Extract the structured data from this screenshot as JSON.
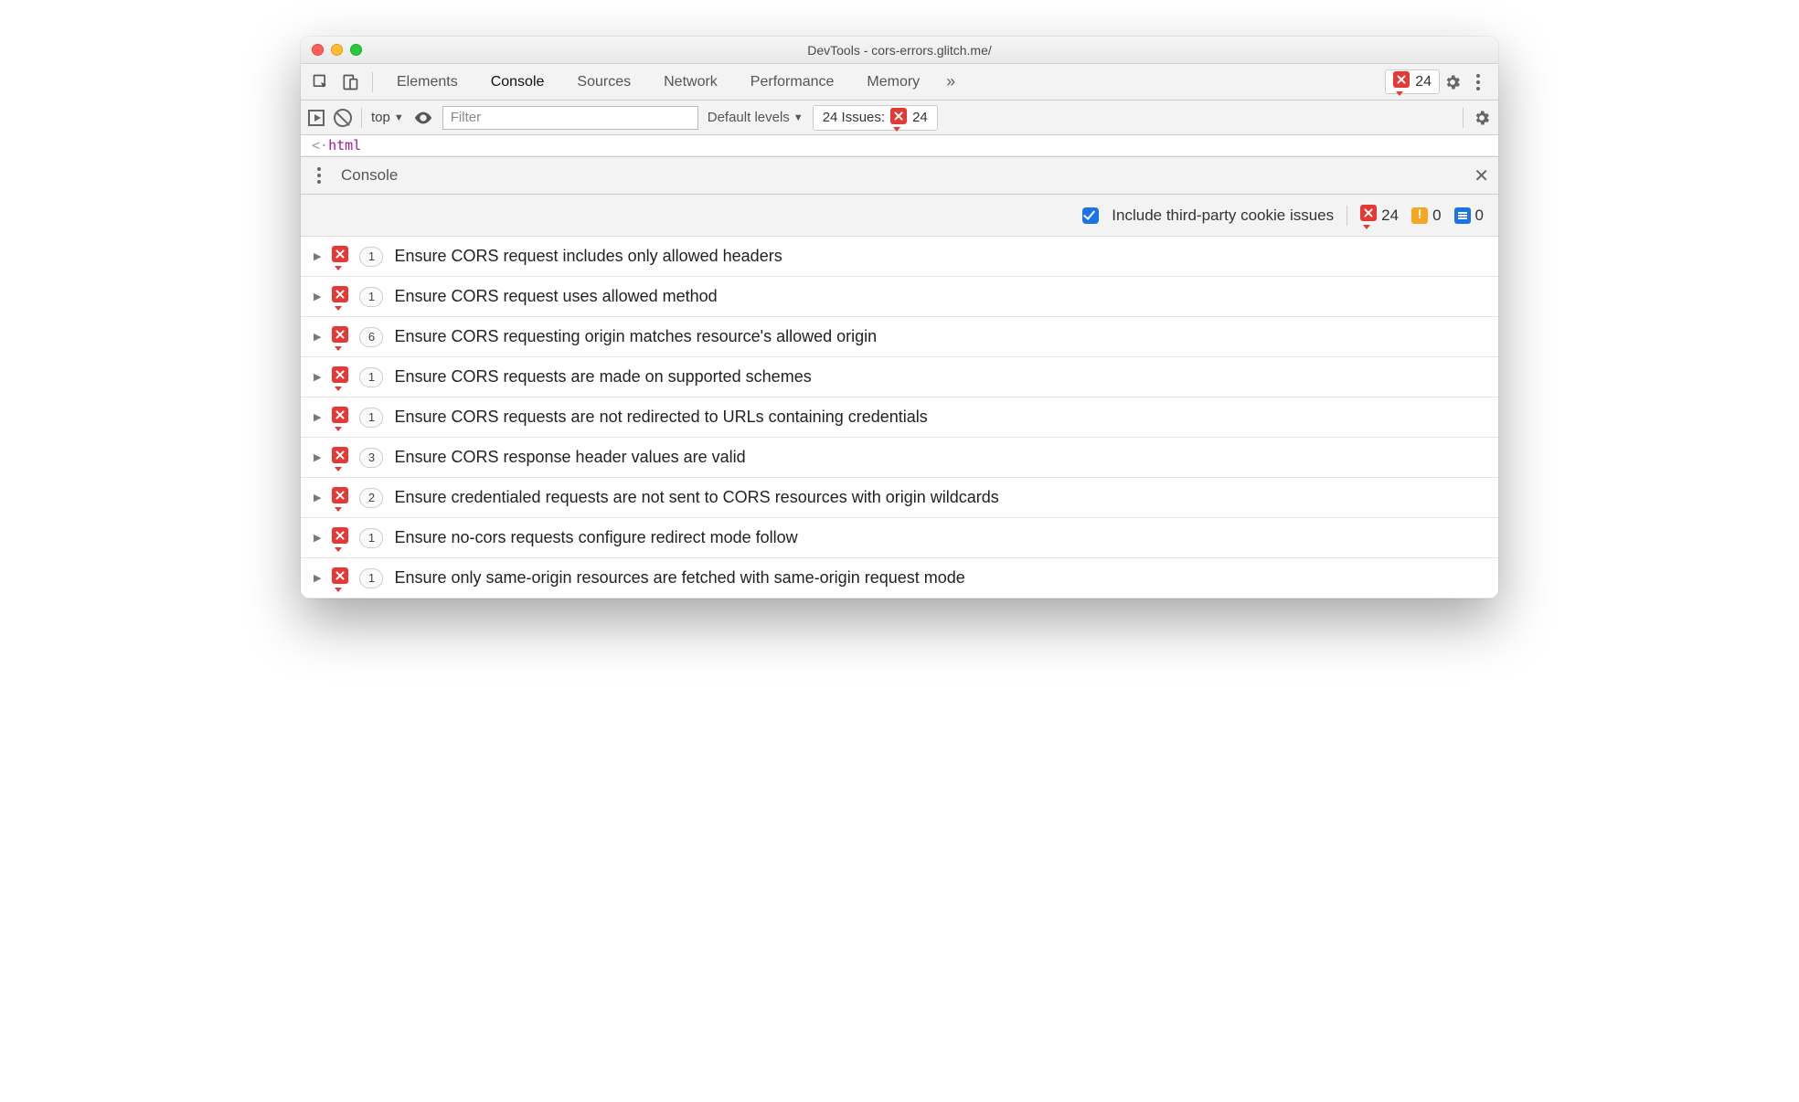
{
  "window": {
    "title": "DevTools - cors-errors.glitch.me/"
  },
  "tabs": {
    "items": [
      "Elements",
      "Console",
      "Sources",
      "Network",
      "Performance",
      "Memory"
    ],
    "active_index": 1,
    "overflow_glyph": "»",
    "error_count": "24"
  },
  "console_toolbar": {
    "context": "top",
    "filter_placeholder": "Filter",
    "levels_label": "Default levels",
    "issues_label": "24 Issues:",
    "issues_count": "24"
  },
  "source_snippet": {
    "text": "html",
    "prefix": "<·"
  },
  "drawer": {
    "label": "Console"
  },
  "cookie_bar": {
    "checkbox_label": "Include third-party cookie issues",
    "checked": true,
    "errors": "24",
    "warnings": "0",
    "info": "0"
  },
  "issues": [
    {
      "count": "1",
      "text": "Ensure CORS request includes only allowed headers"
    },
    {
      "count": "1",
      "text": "Ensure CORS request uses allowed method"
    },
    {
      "count": "6",
      "text": "Ensure CORS requesting origin matches resource's allowed origin"
    },
    {
      "count": "1",
      "text": "Ensure CORS requests are made on supported schemes"
    },
    {
      "count": "1",
      "text": "Ensure CORS requests are not redirected to URLs containing credentials"
    },
    {
      "count": "3",
      "text": "Ensure CORS response header values are valid"
    },
    {
      "count": "2",
      "text": "Ensure credentialed requests are not sent to CORS resources with origin wildcards"
    },
    {
      "count": "1",
      "text": "Ensure no-cors requests configure redirect mode follow"
    },
    {
      "count": "1",
      "text": "Ensure only same-origin resources are fetched with same-origin request mode"
    }
  ]
}
